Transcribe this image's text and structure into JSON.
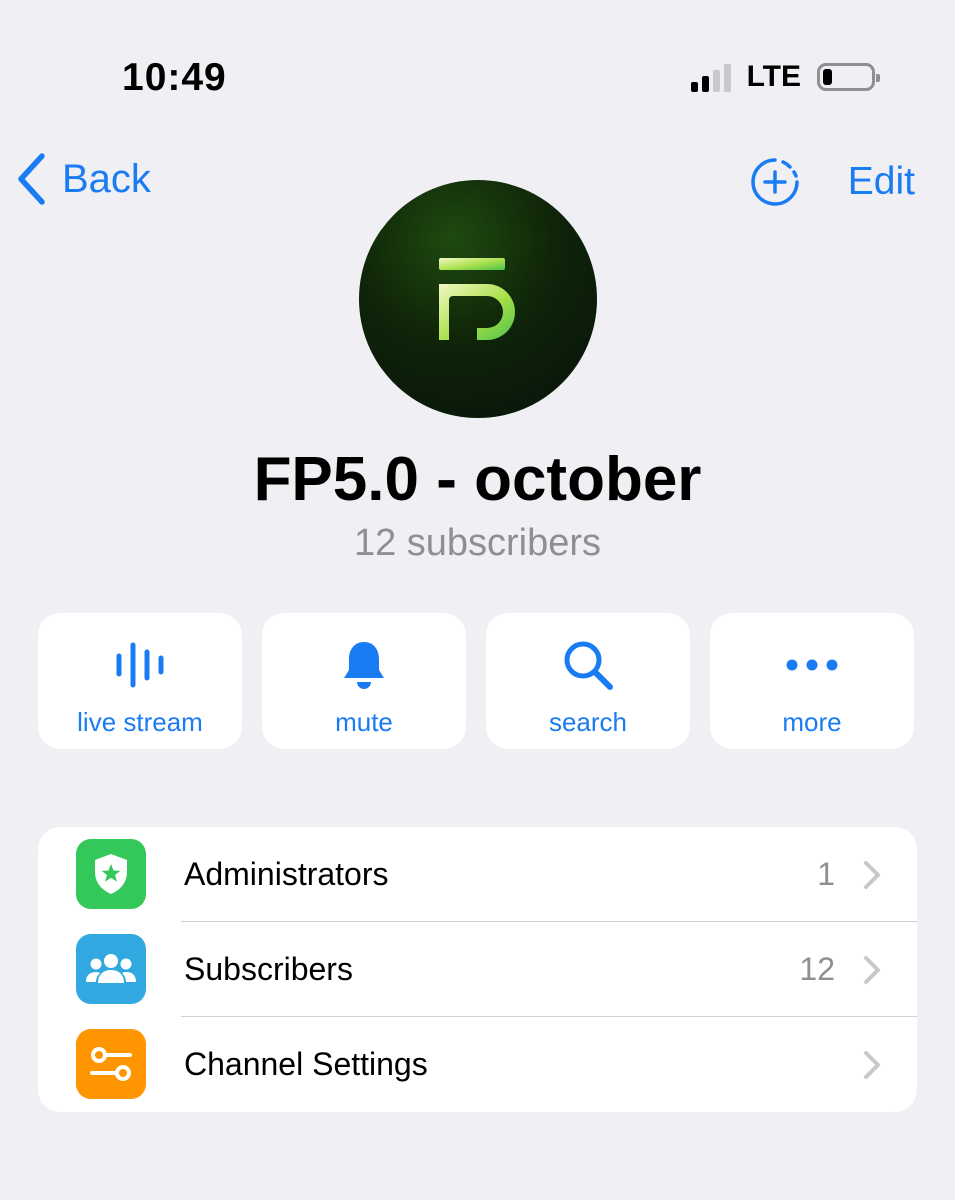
{
  "status_bar": {
    "time": "10:49",
    "network": "LTE",
    "signal_bars": 2,
    "battery_level": 0.15
  },
  "nav": {
    "back_label": "Back",
    "edit_label": "Edit"
  },
  "channel": {
    "name": "FP5.0 - october",
    "subscribers_text": "12 subscribers"
  },
  "actions": [
    {
      "label": "live stream",
      "icon": "live-stream-icon"
    },
    {
      "label": "mute",
      "icon": "bell-icon"
    },
    {
      "label": "search",
      "icon": "search-icon"
    },
    {
      "label": "more",
      "icon": "more-icon"
    }
  ],
  "rows": [
    {
      "label": "Administrators",
      "count": "1",
      "icon": "shield-star-icon",
      "color": "#34c759"
    },
    {
      "label": "Subscribers",
      "count": "12",
      "icon": "people-icon",
      "color": "#32a8e0"
    },
    {
      "label": "Channel Settings",
      "count": "",
      "icon": "sliders-icon",
      "color": "#ff9500"
    }
  ],
  "colors": {
    "accent": "#1a7cf3",
    "background": "#efeff4",
    "secondary_text": "#8e8e93"
  }
}
